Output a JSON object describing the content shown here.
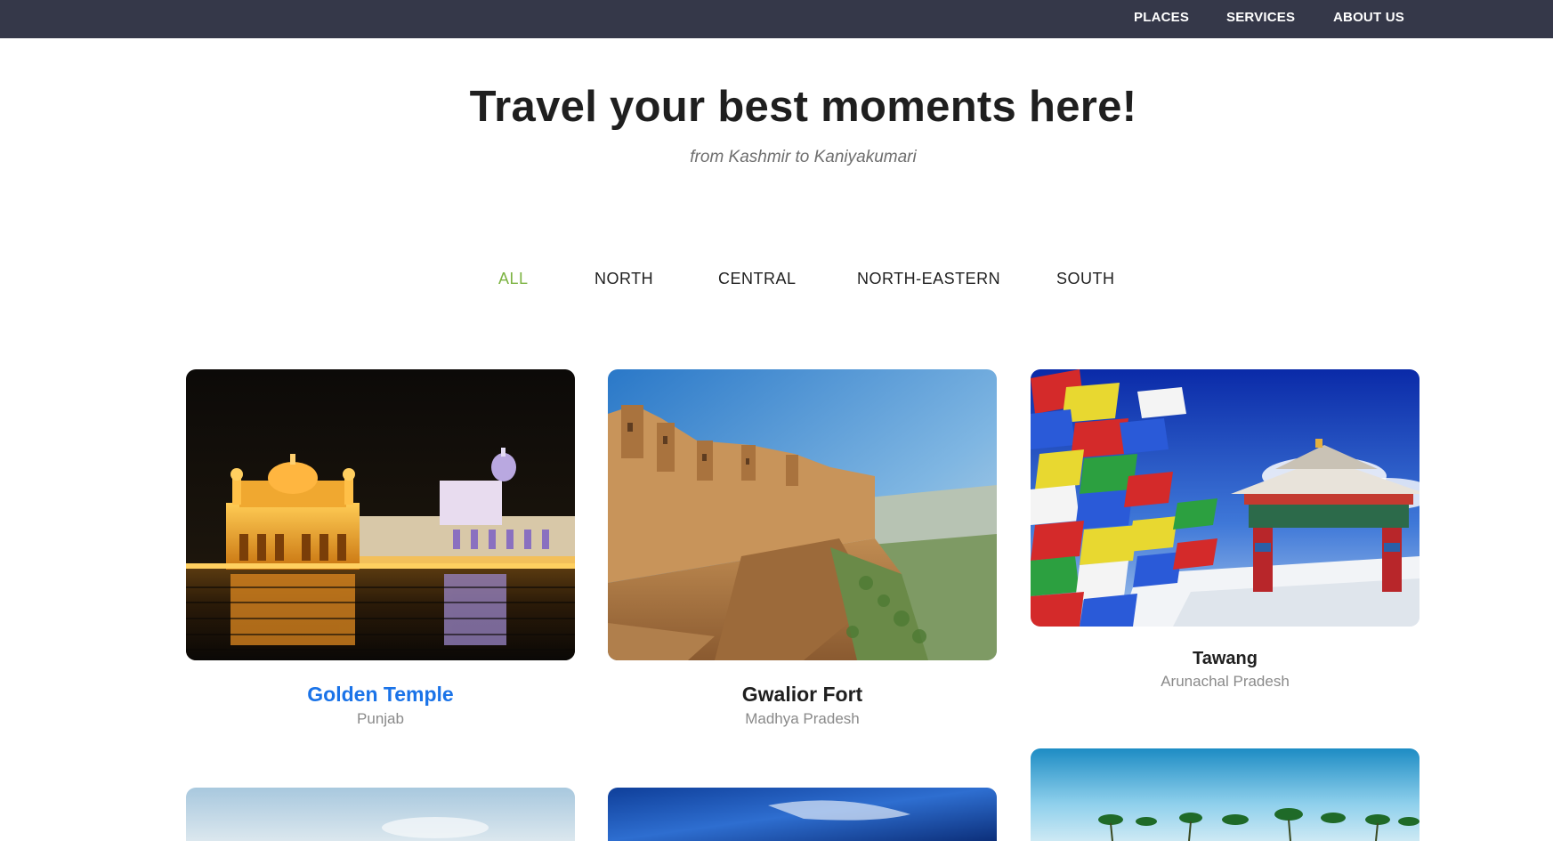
{
  "nav": {
    "items": [
      {
        "label": "PLACES"
      },
      {
        "label": "SERVICES"
      },
      {
        "label": "ABOUT US"
      }
    ]
  },
  "hero": {
    "title": "Travel your best moments here!",
    "subtitle": "from Kashmir to Kaniyakumari"
  },
  "filters": [
    {
      "label": "ALL",
      "active": true
    },
    {
      "label": "NORTH",
      "active": false
    },
    {
      "label": "CENTRAL",
      "active": false
    },
    {
      "label": "NORTH-EASTERN",
      "active": false
    },
    {
      "label": "SOUTH",
      "active": false
    }
  ],
  "cards": [
    {
      "title": "Golden Temple",
      "region": "Punjab",
      "image": "golden-temple-night"
    },
    {
      "title": "Gwalior Fort",
      "region": "Madhya Pradesh",
      "image": "gwalior-fort-cliff"
    },
    {
      "title": "Tawang",
      "region": "Arunachal Pradesh",
      "image": "tawang-prayer-flags-gate"
    }
  ],
  "colors": {
    "topbar": "#353849",
    "active_filter": "#7cb342",
    "link_title": "#1a73e8"
  }
}
